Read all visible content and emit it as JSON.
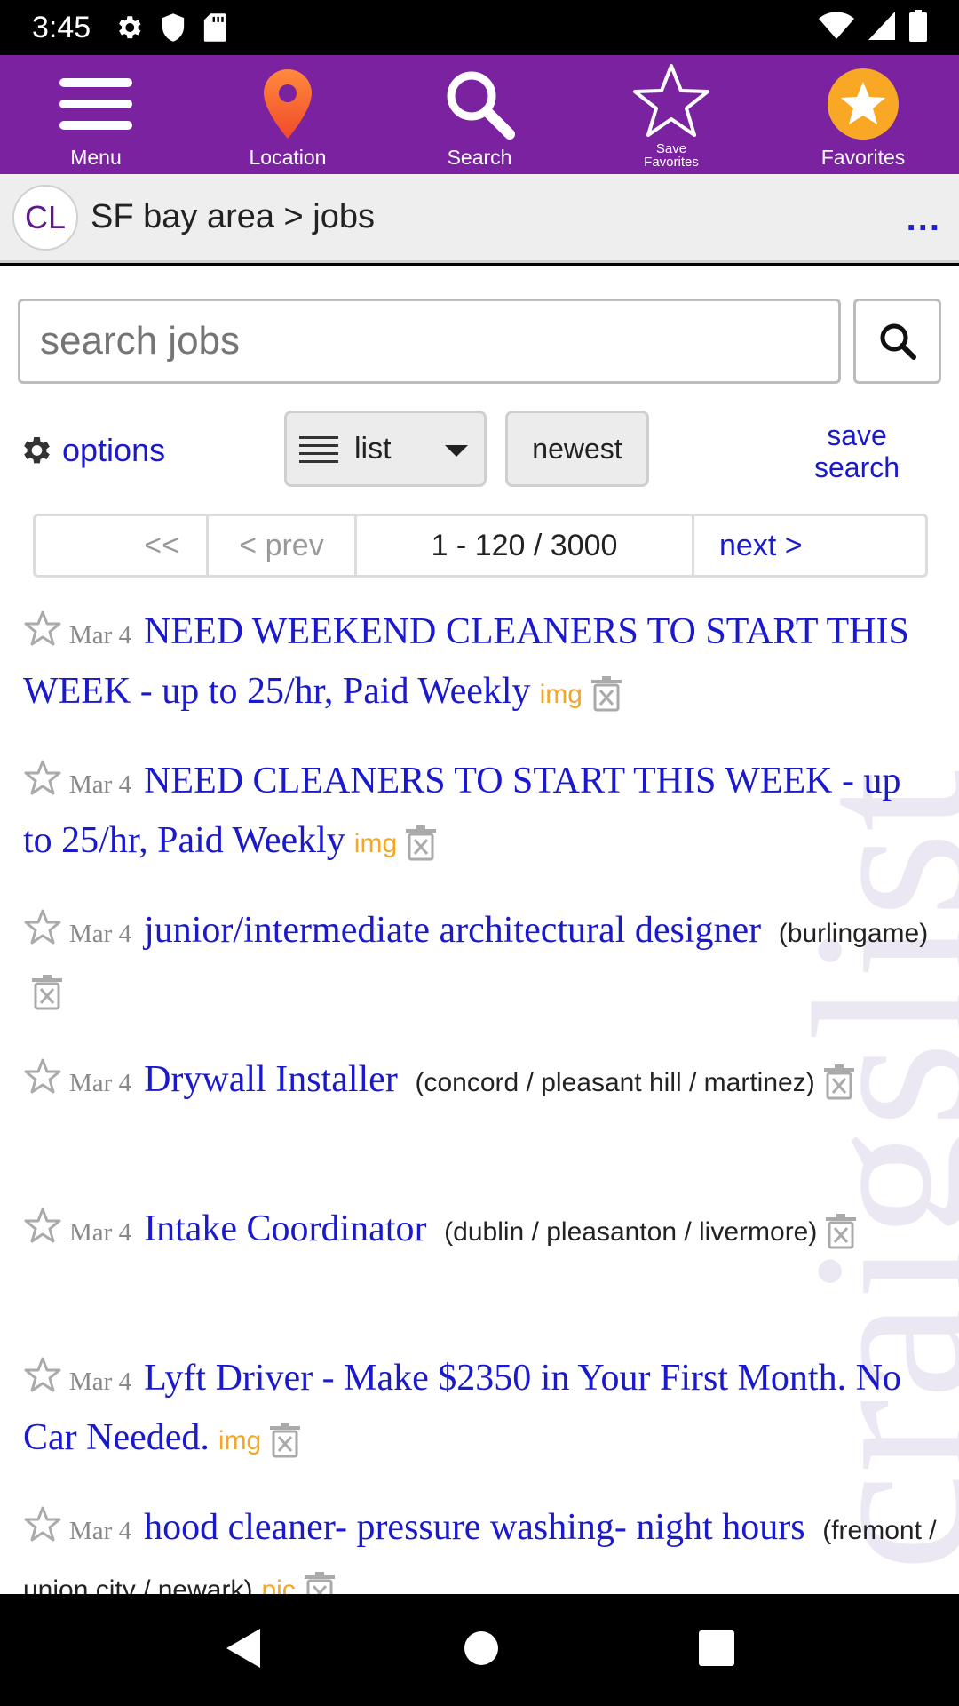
{
  "status_bar": {
    "time": "3:45",
    "left_icons": [
      "settings-icon",
      "shield-icon",
      "sd-card-icon"
    ],
    "right_icons": [
      "wifi-icon",
      "cell-signal-icon",
      "battery-icon"
    ]
  },
  "toolbar": {
    "color": "#7a22a0",
    "items": [
      {
        "label": "Menu",
        "icon": "menu-icon"
      },
      {
        "label": "Location",
        "icon": "location-pin-icon"
      },
      {
        "label": "Search",
        "icon": "search-icon"
      },
      {
        "label": "Save Favorites",
        "label_line1": "Save",
        "label_line2": "Favorites",
        "icon": "star-outline-icon"
      },
      {
        "label": "Favorites",
        "icon": "star-badge-icon"
      }
    ]
  },
  "breadcrumb": {
    "logo": "CL",
    "text": "SF bay area > jobs",
    "more": "..."
  },
  "search": {
    "placeholder": "search jobs"
  },
  "controls": {
    "options_label": "options",
    "view_label": "list",
    "sort_label": "newest",
    "save_search_line1": "save",
    "save_search_line2": "search"
  },
  "pager": {
    "first": "<<",
    "prev": "< prev",
    "range": "1 - 120 / 3000",
    "next": "next >"
  },
  "watermark": "craigslist",
  "results": [
    {
      "date": "Mar 4",
      "title": "NEED WEEKEND CLEANERS TO START THIS WEEK - up to 25/hr, Paid Weekly",
      "location": "",
      "tag": "img"
    },
    {
      "date": "Mar 4",
      "title": "NEED CLEANERS TO START THIS WEEK - up to 25/hr, Paid Weekly",
      "location": "",
      "tag": "img"
    },
    {
      "date": "Mar 4",
      "title": "junior/intermediate architectural designer",
      "location": "(burlingame)",
      "tag": ""
    },
    {
      "date": "Mar 4",
      "title": "Drywall Installer",
      "location": "(concord / pleasant hill / martinez)",
      "tag": ""
    },
    {
      "date": "Mar 4",
      "title": "Intake Coordinator",
      "location": "(dublin / pleasanton / livermore)",
      "tag": ""
    },
    {
      "date": "Mar 4",
      "title": "Lyft Driver - Make $2350 in Your First Month. No Car Needed.",
      "location": "",
      "tag": "img"
    },
    {
      "date": "Mar 4",
      "title": "hood cleaner- pressure washing- night hours",
      "location": "(fremont / union city / newark)",
      "tag": "pic"
    }
  ],
  "colors": {
    "link": "#1a1acc",
    "tag": "#f5a623",
    "accent": "#7a22a0",
    "favorites_badge": "#f9a825"
  }
}
